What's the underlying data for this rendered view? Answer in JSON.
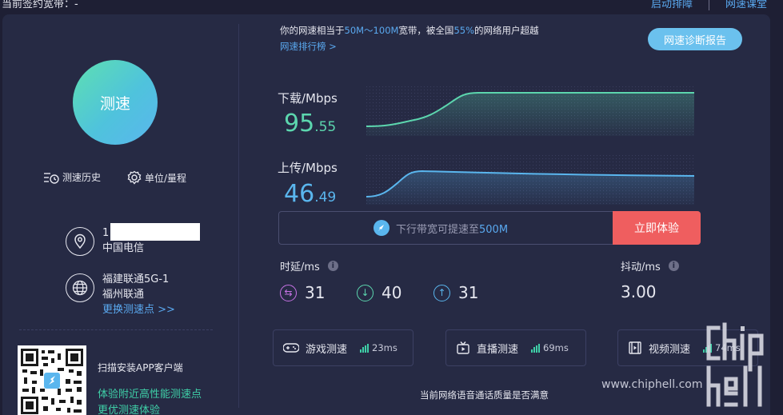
{
  "topbar": {
    "left_text": "当前签约宽带：-",
    "links": [
      "启动排障",
      "网速课堂"
    ]
  },
  "left": {
    "speed_button": "测速",
    "history_link": "测速历史",
    "unit_link": "单位/量程",
    "isp": {
      "ip_prefix": "1",
      "name": "中国电信"
    },
    "server": {
      "name": "福建联通5G-1",
      "city": "福州联通",
      "change_link": "更换测速点 >>"
    },
    "app": {
      "title": "扫描安装APP客户端",
      "line1": "体验附近高性能测速点",
      "line2": "更优测速体验"
    }
  },
  "rank": {
    "prefix": "你的网速相当于",
    "range": "50M～100M",
    "middle": "宽带，被全国",
    "percent": "55%",
    "suffix": "的网络用户超越",
    "link": "网速排行榜 >",
    "diag_button": "网速诊断报告"
  },
  "download": {
    "label": "下载/Mbps",
    "int": "95",
    "dec": ".55"
  },
  "upload": {
    "label": "上传/Mbps",
    "int": "46",
    "dec": ".49"
  },
  "promo": {
    "text_pre": "下行带宽可提速至",
    "highlight": "500M",
    "cta": "立即体验"
  },
  "latency": {
    "label": "时延/ms",
    "idle": "31",
    "down": "40",
    "up": "31"
  },
  "jitter": {
    "label": "抖动/ms",
    "value": "3.00"
  },
  "cards": [
    {
      "label": "游戏测速",
      "value": "23ms",
      "icon": "gamepad-icon"
    },
    {
      "label": "直播测速",
      "value": "69ms",
      "icon": "tv-icon"
    },
    {
      "label": "视频测速",
      "value": "74ms",
      "icon": "film-icon"
    }
  ],
  "bottom_question": "当前网络语音通话质量是否满意",
  "watermark": {
    "url": "www.chiphell.com"
  },
  "colors": {
    "accent_green": "#5cd6ae",
    "accent_blue": "#5ab6ee",
    "cta_red": "#ef5e5f"
  }
}
